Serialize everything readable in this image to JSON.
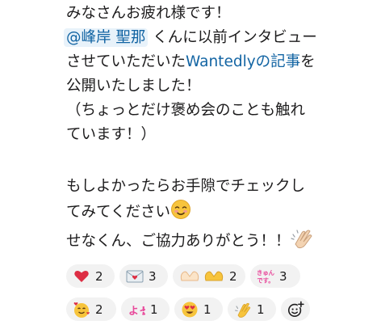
{
  "message": {
    "line1": "みなさんお疲れ様です！",
    "mention": "@峰岸 聖那",
    "line2_rest": " くんに以前インタビュー",
    "line3_before": "させていただいた",
    "line3_link": "Wantedlyの記事",
    "line3_after": "を",
    "line4": "公開いたしました！",
    "line5": "（ちょっとだけ褒め会のことも触れ",
    "line6": "ています！）",
    "line7": "もしよかったらお手隙でチェックし",
    "line8": "てみてください",
    "line9": "せなくん、ご協力ありがとう！！"
  },
  "reactions": [
    {
      "icon": "red-heart-icon",
      "count": "2"
    },
    {
      "icon": "love-letter-icon",
      "count": "3"
    },
    {
      "icon": "heart-hands-icon",
      "count": "2"
    },
    {
      "icon": "kyun-desu-icon",
      "label": "きゅんです。",
      "count": "3"
    },
    {
      "icon": "smiling-face-hearts-icon",
      "count": "2"
    },
    {
      "icon": "yo-icon",
      "label": "よっ!",
      "count": "1"
    },
    {
      "icon": "heart-eyes-icon",
      "count": "1"
    },
    {
      "icon": "clapping-hands-icon",
      "count": "1"
    }
  ],
  "colors": {
    "link": "#1264a3",
    "mention_bg": "#e8f2fa",
    "pill_bg": "#f2f2f2"
  }
}
